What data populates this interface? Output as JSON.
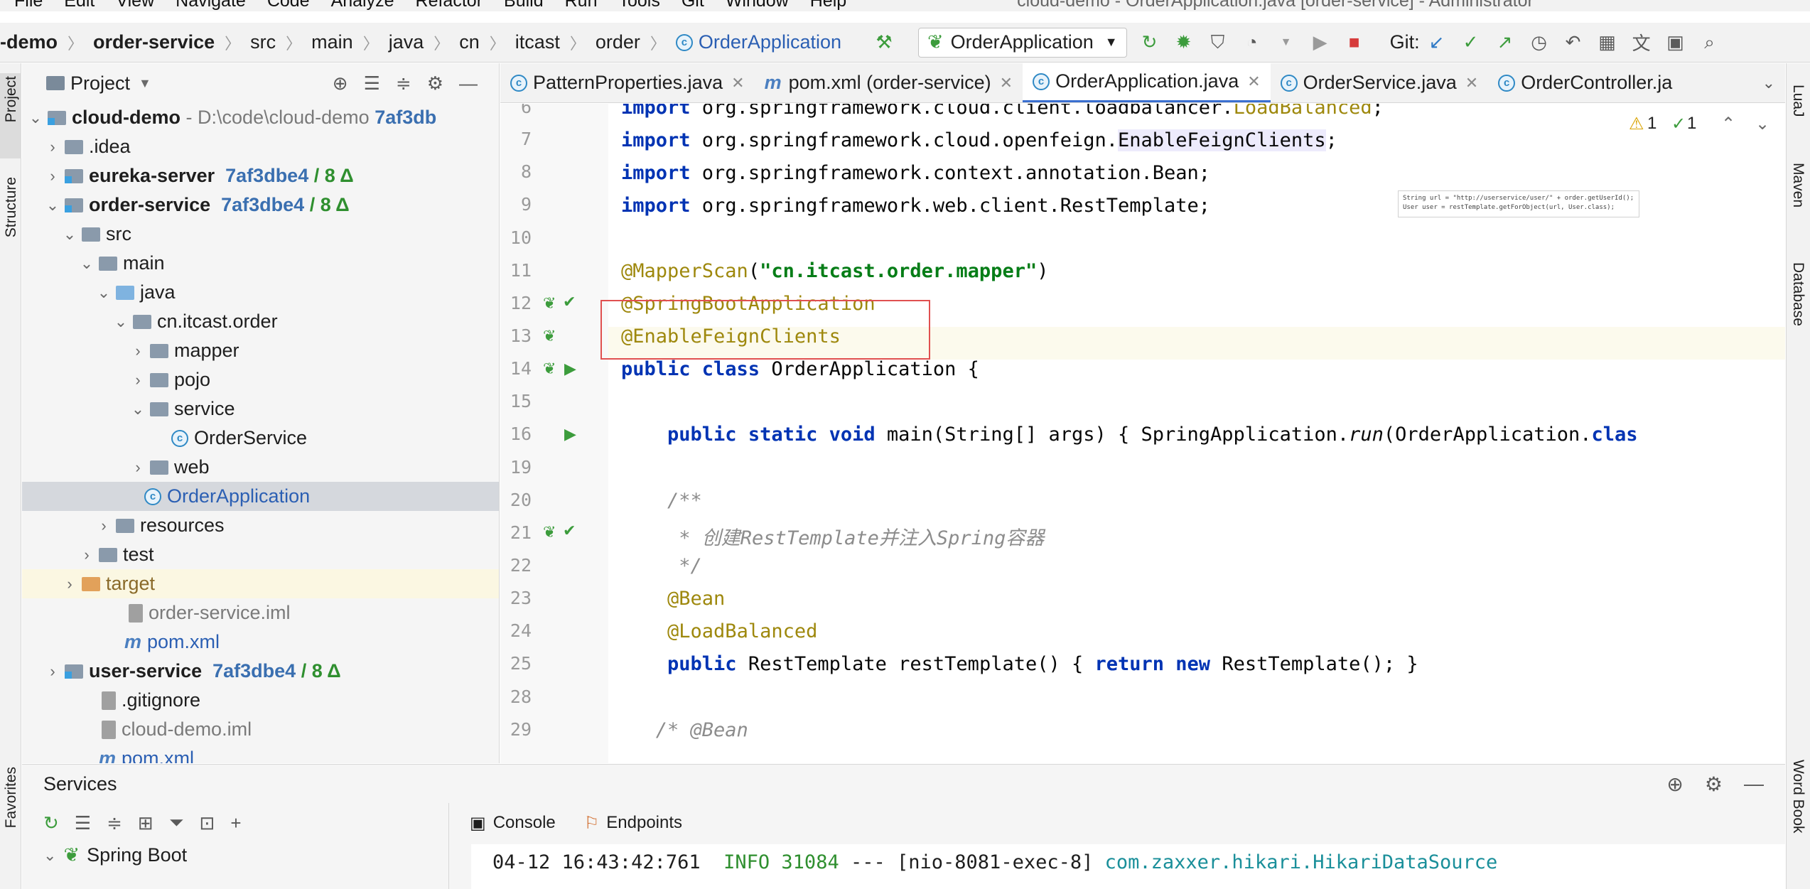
{
  "menu": {
    "items": [
      "File",
      "Edit",
      "View",
      "Navigate",
      "Code",
      "Analyze",
      "Refactor",
      "Build",
      "Run",
      "Tools",
      "Git",
      "Window",
      "Help"
    ],
    "title": "cloud-demo - OrderApplication.java [order-service] - Administrator"
  },
  "breadcrumb": [
    "-demo",
    "order-service",
    "src",
    "main",
    "java",
    "cn",
    "itcast",
    "order",
    "OrderApplication"
  ],
  "toolbar": {
    "run_config": "OrderApplication",
    "git_label": "Git:"
  },
  "left_stripe": {
    "project": "Project",
    "structure": "Structure",
    "favorites": "Favorites"
  },
  "right_stripe": {
    "luaj": "LuaJ",
    "maven": "Maven",
    "database": "Database",
    "wordbook": "Word Book"
  },
  "project_panel": {
    "title": "Project",
    "tree": [
      {
        "name": "cloud-demo",
        "path": "D:\\code\\cloud-demo",
        "hash": "7af3db"
      },
      {
        "name": ".idea"
      },
      {
        "name": "eureka-server",
        "hash": "7af3dbe4",
        "changes": "/ 8 Δ"
      },
      {
        "name": "order-service",
        "hash": "7af3dbe4",
        "changes": "/ 8 Δ"
      },
      {
        "name": "src"
      },
      {
        "name": "main"
      },
      {
        "name": "java"
      },
      {
        "name": "cn.itcast.order"
      },
      {
        "name": "mapper"
      },
      {
        "name": "pojo"
      },
      {
        "name": "service"
      },
      {
        "name": "OrderService"
      },
      {
        "name": "web"
      },
      {
        "name": "OrderApplication"
      },
      {
        "name": "resources"
      },
      {
        "name": "test"
      },
      {
        "name": "target"
      },
      {
        "name": "order-service.iml"
      },
      {
        "name": "pom.xml"
      },
      {
        "name": "user-service",
        "hash": "7af3dbe4",
        "changes": "/ 8 Δ"
      },
      {
        "name": ".gitignore"
      },
      {
        "name": "cloud-demo.iml"
      },
      {
        "name": "pom.xml"
      }
    ]
  },
  "tabs": [
    {
      "label": "PatternProperties.java"
    },
    {
      "label": "pom.xml (order-service)"
    },
    {
      "label": "OrderApplication.java"
    },
    {
      "label": "OrderService.java"
    },
    {
      "label": "OrderController.ja"
    }
  ],
  "editor": {
    "warnings": "1",
    "checks": "1",
    "inlay_line1": "String url = \"http://userservice/user/\" + order.getUserId();",
    "inlay_line2": "User user = restTemplate.getForObject(url, User.class);",
    "lines": [
      {
        "n": "6",
        "text": "import org.springframework.cloud.client.loadbalancer.LoadBalanced;"
      },
      {
        "n": "7",
        "text": "import org.springframework.cloud.openfeign.EnableFeignClients;"
      },
      {
        "n": "8",
        "text": "import org.springframework.context.annotation.Bean;"
      },
      {
        "n": "9",
        "text": "import org.springframework.web.client.RestTemplate;"
      },
      {
        "n": "10",
        "text": ""
      },
      {
        "n": "11",
        "text": "@MapperScan(\"cn.itcast.order.mapper\")"
      },
      {
        "n": "12",
        "text": "@SpringBootApplication"
      },
      {
        "n": "13",
        "text": "@EnableFeignClients"
      },
      {
        "n": "14",
        "text": "public class OrderApplication {"
      },
      {
        "n": "15",
        "text": ""
      },
      {
        "n": "16",
        "text": "    public static void main(String[] args) { SpringApplication.run(OrderApplication.clas"
      },
      {
        "n": "19",
        "text": ""
      },
      {
        "n": "20",
        "text": "    /**"
      },
      {
        "n": "21",
        "text": "     * 创建RestTemplate并注入Spring容器"
      },
      {
        "n": "22",
        "text": "     */"
      },
      {
        "n": "23",
        "text": "    @Bean"
      },
      {
        "n": "24",
        "text": "    @LoadBalanced"
      },
      {
        "n": "25",
        "text": "    public RestTemplate restTemplate() { return new RestTemplate(); }"
      },
      {
        "n": "28",
        "text": ""
      },
      {
        "n": "29",
        "text": "   /* @Bean"
      }
    ]
  },
  "services": {
    "title": "Services",
    "tab_console": "Console",
    "tab_endpoints": "Endpoints",
    "spring_boot": "Spring Boot",
    "log": {
      "time": "04-12 16:43:42:761",
      "level": "INFO",
      "pid": "31084",
      "sep": "---",
      "thread": "[nio-8081-exec-8]",
      "logger": "com.zaxxer.hikari.HikariDataSource"
    }
  }
}
